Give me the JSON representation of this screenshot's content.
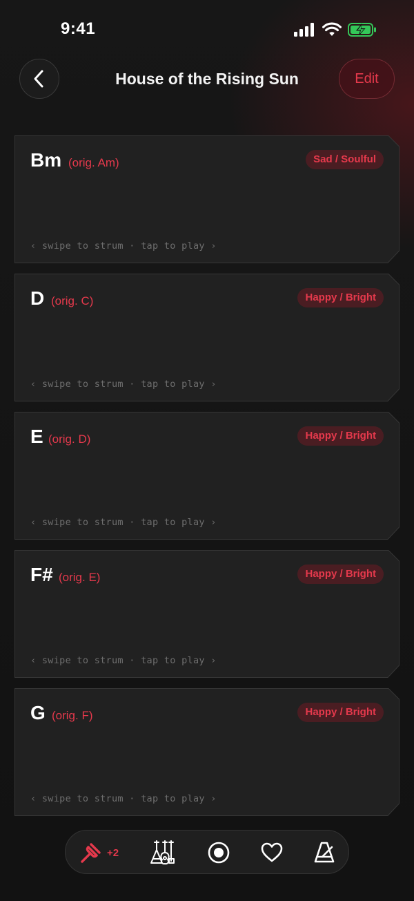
{
  "status": {
    "time": "9:41"
  },
  "header": {
    "title": "House of the Rising Sun",
    "edit_label": "Edit"
  },
  "chords": [
    {
      "name": "Bm",
      "original": "(orig. Am)",
      "mood": "Sad / Soulful",
      "hint": "‹ swipe to strum · tap to play ›"
    },
    {
      "name": "D",
      "original": "(orig. C)",
      "mood": "Happy / Bright",
      "hint": "‹ swipe to strum · tap to play ›"
    },
    {
      "name": "E",
      "original": "(orig. D)",
      "mood": "Happy / Bright",
      "hint": "‹ swipe to strum · tap to play ›"
    },
    {
      "name": "F#",
      "original": "(orig. E)",
      "mood": "Happy / Bright",
      "hint": "‹ swipe to strum · tap to play ›"
    },
    {
      "name": "G",
      "original": "(orig. F)",
      "mood": "Happy / Bright",
      "hint": "‹ swipe to strum · tap to play ›"
    }
  ],
  "toolbar": {
    "transpose": "+2",
    "icons": [
      "tuning-fork-icon",
      "instruments-icon",
      "record-icon",
      "heart-icon",
      "metronome-icon"
    ]
  },
  "colors": {
    "accent": "#e5394c",
    "badge_bg": "#4a1d22",
    "card_bg": "#212121",
    "background": "#141414"
  }
}
